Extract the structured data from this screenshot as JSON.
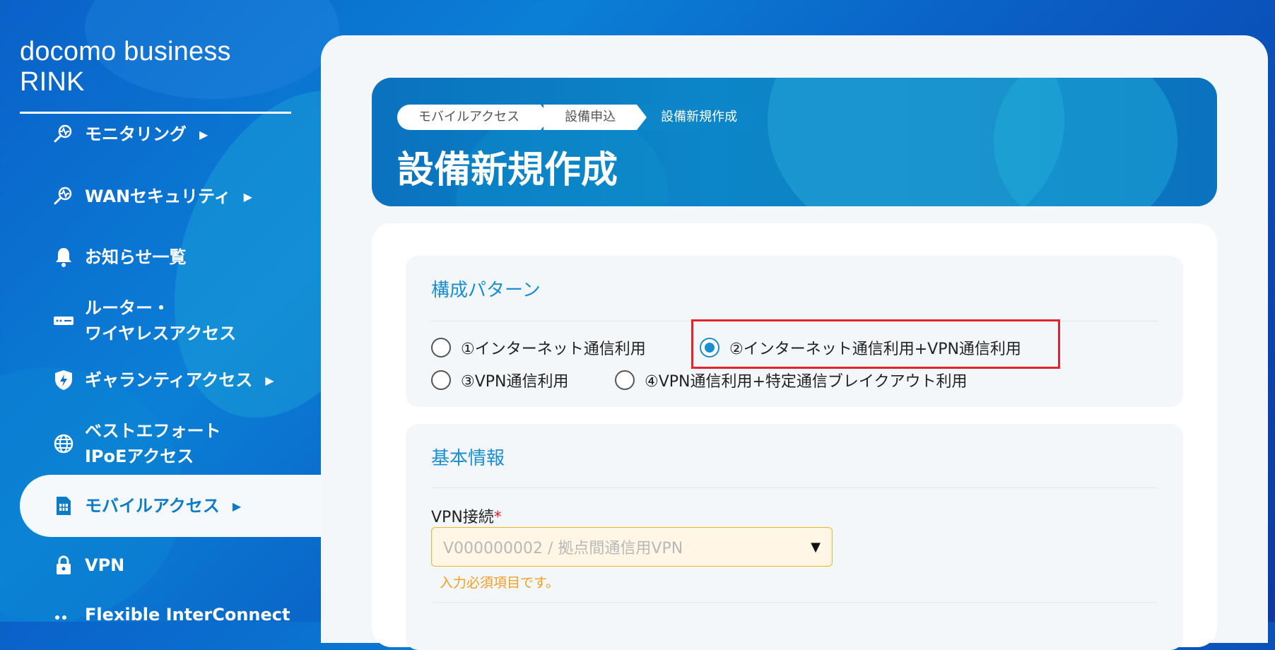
{
  "brand": "docomo business RINK",
  "sidebar": {
    "items": [
      {
        "label": "モニタリング",
        "arrow": "▶"
      },
      {
        "label": "WANセキュリティ",
        "arrow": "▶"
      },
      {
        "label": "お知らせ一覧",
        "arrow": ""
      },
      {
        "label": "ルーター・",
        "label2": "ワイヤレスアクセス",
        "arrow": ""
      },
      {
        "label": "ギャランティアクセス",
        "arrow": "▶"
      },
      {
        "label": "ベストエフォート",
        "label2": "IPoEアクセス",
        "arrow": ""
      },
      {
        "label": "モバイルアクセス",
        "arrow": "▶",
        "active": true
      },
      {
        "label": "VPN",
        "arrow": ""
      },
      {
        "label": "Flexible InterConnect",
        "arrow": ""
      }
    ]
  },
  "breadcrumb": [
    "モバイルアクセス",
    "設備申込",
    "設備新規作成"
  ],
  "page_title": "設備新規作成",
  "config_section": {
    "title": "構成パターン",
    "options": [
      {
        "label": "①インターネット通信利用",
        "checked": false
      },
      {
        "label": "②インターネット通信利用+VPN通信利用",
        "checked": true
      },
      {
        "label": "③VPN通信利用",
        "checked": false
      },
      {
        "label": "④VPN通信利用+特定通信ブレイクアウト利用",
        "checked": false
      }
    ]
  },
  "basic_section": {
    "title": "基本情報",
    "vpn_label": "VPN接続",
    "required_mark": "*",
    "vpn_placeholder": "V000000002 / 拠点間通信用VPN",
    "error": "入力必須項目です。",
    "caret": "▼"
  },
  "colors": {
    "accent": "#1a8fd0",
    "error": "#e1252a",
    "warning": "#f0a020"
  }
}
